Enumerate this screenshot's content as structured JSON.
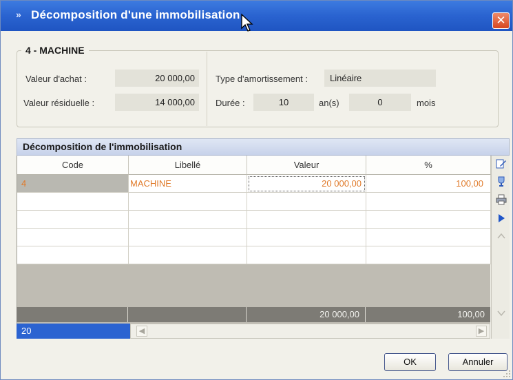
{
  "window": {
    "title": "Décomposition d'une immobilisation",
    "close_glyph": "✕",
    "title_chevron": "»"
  },
  "asset": {
    "group_title": "4 - MACHINE",
    "purchase_value_label": "Valeur d'achat :",
    "purchase_value": "20 000,00",
    "residual_value_label": "Valeur résiduelle :",
    "residual_value": "14 000,00",
    "depreciation_type_label": "Type d'amortissement :",
    "depreciation_type": "Linéaire",
    "duration_label": "Durée :",
    "duration_years": "10",
    "years_unit": "an(s)",
    "duration_months": "0",
    "months_unit": "mois"
  },
  "grid": {
    "panel_title": "Décomposition de l'immobilisation",
    "columns": [
      "Code",
      "Libellé",
      "Valeur",
      "%"
    ],
    "rows": [
      {
        "code": "4",
        "label": "MACHINE",
        "value": "20 000,00",
        "percent": "100,00"
      }
    ],
    "totals": {
      "value": "20 000,00",
      "percent": "100,00"
    },
    "status_count": "20"
  },
  "toolbar": {
    "icons": [
      "edit-icon",
      "trophy-icon",
      "print-icon",
      "play-icon",
      "scroll-up-icon",
      "scroll-down-icon"
    ]
  },
  "buttons": {
    "ok": "OK",
    "cancel": "Annuler"
  },
  "colors": {
    "title_bar": "#2a63d0",
    "cell_text": "#e07a2a",
    "status_bar": "#2b63d1",
    "close": "#d6461f"
  }
}
